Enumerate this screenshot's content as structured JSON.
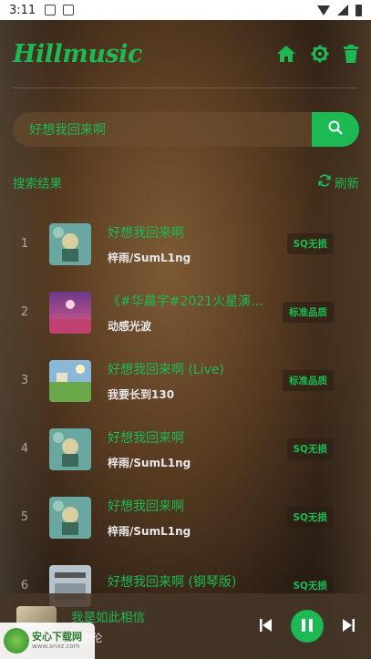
{
  "status_bar": {
    "time": "3:11"
  },
  "app": {
    "logo": "Hillmusic"
  },
  "search": {
    "value": "好想我回来啊"
  },
  "section": {
    "title": "搜索结果",
    "refresh_label": "刷新"
  },
  "songs": [
    {
      "index": "1",
      "title": "好想我回来啊",
      "artist": "梓雨/SumL1ng",
      "quality": "SQ无损",
      "cover": "#6aa7a0"
    },
    {
      "index": "2",
      "title": "《#华晨宇#2021火星演…",
      "artist": "动感光波",
      "quality": "标准品质",
      "cover": "#b04a7a"
    },
    {
      "index": "3",
      "title": "好想我回来啊 (Live)",
      "artist": "我要长到130",
      "quality": "标准品质",
      "cover": "#7aa85a"
    },
    {
      "index": "4",
      "title": "好想我回来啊",
      "artist": "梓雨/SumL1ng",
      "quality": "SQ无损",
      "cover": "#6aa7a0"
    },
    {
      "index": "5",
      "title": "好想我回来啊",
      "artist": "梓雨/SumL1ng",
      "quality": "SQ无损",
      "cover": "#6aa7a0"
    },
    {
      "index": "6",
      "title": "好想我回来啊 (钢琴版)",
      "artist": "",
      "quality": "SQ无损",
      "cover": "#9aa6b0"
    }
  ],
  "player": {
    "title": "我是如此相信",
    "artist": "周杰伦"
  },
  "watermark": {
    "text": "安心下载网",
    "url": "www.anxz.com"
  },
  "colors": {
    "accent": "#1db954"
  }
}
